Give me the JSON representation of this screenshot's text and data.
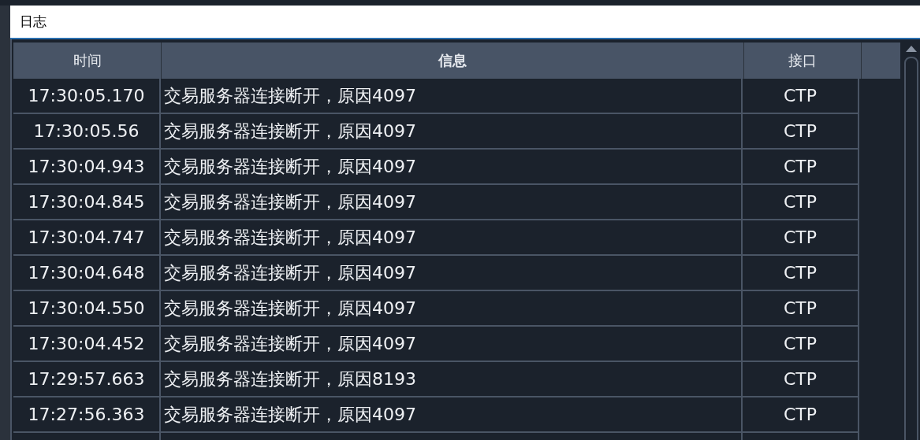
{
  "window": {
    "title": "日志"
  },
  "table": {
    "columns": [
      "时间",
      "信息",
      "接口"
    ],
    "rows": [
      {
        "time": "17:30:05.170",
        "message": "交易服务器连接断开，原因4097",
        "interface": "CTP"
      },
      {
        "time": "17:30:05.56",
        "message": "交易服务器连接断开，原因4097",
        "interface": "CTP"
      },
      {
        "time": "17:30:04.943",
        "message": "交易服务器连接断开，原因4097",
        "interface": "CTP"
      },
      {
        "time": "17:30:04.845",
        "message": "交易服务器连接断开，原因4097",
        "interface": "CTP"
      },
      {
        "time": "17:30:04.747",
        "message": "交易服务器连接断开，原因4097",
        "interface": "CTP"
      },
      {
        "time": "17:30:04.648",
        "message": "交易服务器连接断开，原因4097",
        "interface": "CTP"
      },
      {
        "time": "17:30:04.550",
        "message": "交易服务器连接断开，原因4097",
        "interface": "CTP"
      },
      {
        "time": "17:30:04.452",
        "message": "交易服务器连接断开，原因4097",
        "interface": "CTP"
      },
      {
        "time": "17:29:57.663",
        "message": "交易服务器连接断开，原因8193",
        "interface": "CTP"
      },
      {
        "time": "17:27:56.363",
        "message": "交易服务器连接断开，原因4097",
        "interface": "CTP"
      }
    ]
  }
}
